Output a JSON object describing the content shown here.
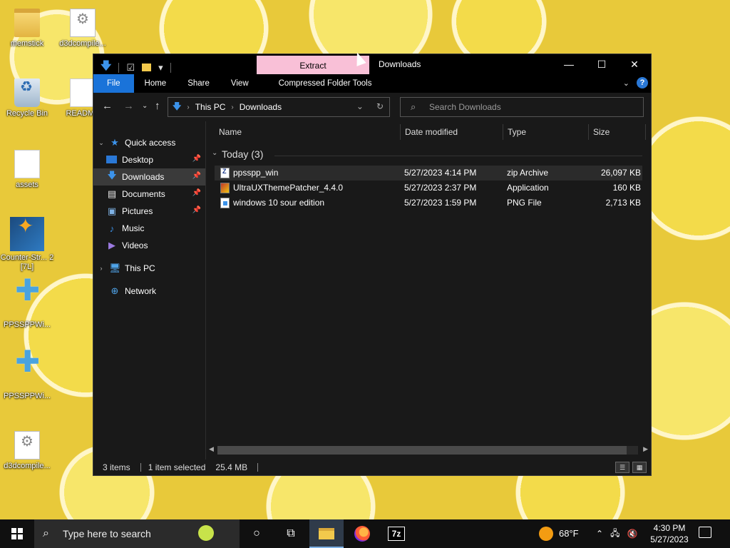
{
  "desktop": {
    "icons": [
      {
        "label": "memstick"
      },
      {
        "label": "d3dcompile..."
      },
      {
        "label": "Recycle Bin"
      },
      {
        "label": "README"
      },
      {
        "label": "assets"
      },
      {
        "label": "Counter-Str... 2 [7L]"
      },
      {
        "label": "PPSSPPWi..."
      },
      {
        "label": "PPSSPPWi..."
      },
      {
        "label": "d3dcompile..."
      }
    ]
  },
  "window": {
    "title": "Downloads",
    "contextual_tab": "Extract",
    "controls": {
      "minimize": "—",
      "maximize": "☐",
      "close": "✕"
    },
    "ribbon_tabs": [
      "File",
      "Home",
      "Share",
      "View",
      "Compressed Folder Tools"
    ],
    "address": {
      "crumbs": [
        "This PC",
        "Downloads"
      ]
    },
    "search": {
      "placeholder": "Search Downloads"
    },
    "nav_pane": {
      "quick_access": "Quick access",
      "items": [
        {
          "label": "Desktop",
          "pinned": true
        },
        {
          "label": "Downloads",
          "pinned": true
        },
        {
          "label": "Documents",
          "pinned": true
        },
        {
          "label": "Pictures",
          "pinned": true
        },
        {
          "label": "Music",
          "pinned": false
        },
        {
          "label": "Videos",
          "pinned": false
        }
      ],
      "this_pc": "This PC",
      "network": "Network"
    },
    "columns": [
      "Name",
      "Date modified",
      "Type",
      "Size"
    ],
    "group": {
      "title": "Today (3)"
    },
    "files": [
      {
        "name": "ppsspp_win",
        "date": "5/27/2023 4:14 PM",
        "type": "zip Archive",
        "size": "26,097 KB",
        "icon": "zip-icon"
      },
      {
        "name": "UltraUXThemePatcher_4.4.0",
        "date": "5/27/2023 2:37 PM",
        "type": "Application",
        "size": "160 KB",
        "icon": "app-icon"
      },
      {
        "name": "windows 10 sour edition",
        "date": "5/27/2023 1:59 PM",
        "type": "PNG File",
        "size": "2,713 KB",
        "icon": "png-icon"
      }
    ],
    "status": {
      "items": "3 items",
      "selected": "1 item selected",
      "size": "25.4 MB"
    }
  },
  "taskbar": {
    "search_placeholder": "Type here to search",
    "weather": "68°F",
    "time": "4:30 PM",
    "date": "5/27/2023",
    "sevenzip_label": "7z"
  }
}
